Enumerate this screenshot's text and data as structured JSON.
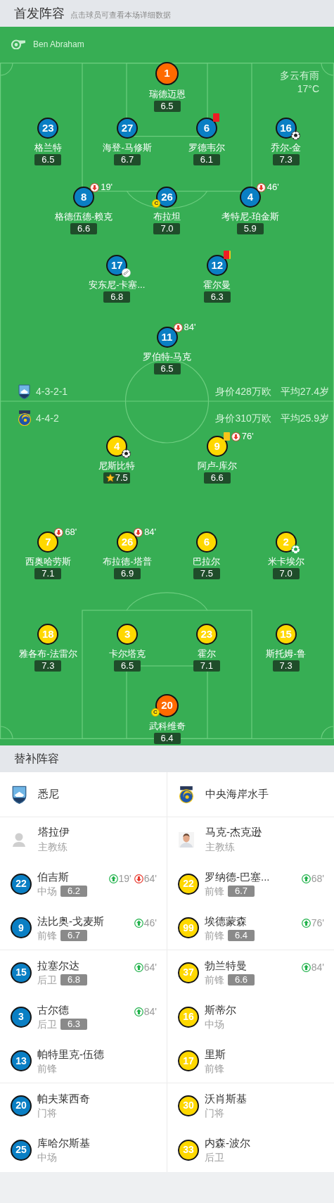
{
  "header": {
    "title": "首发阵容",
    "subtitle": "点击球员可查看本场详细数据"
  },
  "referee": {
    "name": "Ben Abraham"
  },
  "weather": {
    "condition": "多云有雨",
    "temperature": "17°C"
  },
  "home": {
    "color": "#0a7fc4",
    "formation": "4-3-2-1",
    "value": "身价428万欧",
    "avg_age": "平均27.4岁",
    "lines": [
      {
        "players": [
          {
            "kind": "goalkeeper",
            "number": "1",
            "name": "瑞德迈恩",
            "rating": "6.5",
            "mvp": false
          }
        ]
      },
      {
        "players": [
          {
            "kind": "outfield",
            "number": "23",
            "name": "格兰特",
            "rating": "6.5",
            "mvp": false
          },
          {
            "kind": "outfield",
            "number": "27",
            "name": "海登-马修斯",
            "rating": "6.7",
            "mvp": false
          },
          {
            "kind": "outfield",
            "number": "6",
            "name": "罗德韦尔",
            "rating": "6.1",
            "mvp": false,
            "events": [
              {
                "kind": "red_card"
              }
            ]
          },
          {
            "kind": "outfield",
            "number": "16",
            "name": "乔尔-金",
            "rating": "7.3",
            "mvp": false,
            "events": [
              {
                "kind": "goal",
                "color": "#222222"
              }
            ]
          }
        ]
      },
      {
        "players": [
          {
            "kind": "outfield",
            "number": "8",
            "name": "格德伍德-赖克",
            "rating": "6.6",
            "mvp": false,
            "events": [
              {
                "kind": "sub_out",
                "minute": "19'"
              }
            ]
          },
          {
            "kind": "outfield",
            "number": "26",
            "name": "布拉坦",
            "rating": "7.0",
            "mvp": false,
            "events": [
              {
                "kind": "captain",
                "label": "C"
              }
            ]
          },
          {
            "kind": "outfield",
            "number": "4",
            "name": "考特尼-珀金斯",
            "rating": "5.9",
            "mvp": false,
            "events": [
              {
                "kind": "sub_out",
                "minute": "46'"
              }
            ]
          }
        ]
      },
      {
        "players": [
          {
            "kind": "outfield",
            "number": "17",
            "name": "安东尼-卡塞...",
            "rating": "6.8",
            "mvp": false,
            "events": [
              {
                "kind": "assist"
              }
            ]
          },
          {
            "kind": "outfield",
            "number": "12",
            "name": "霍尔曼",
            "rating": "6.3",
            "mvp": false,
            "events": [
              {
                "kind": "second_yellow"
              }
            ]
          }
        ]
      },
      {
        "players": [
          {
            "kind": "outfield",
            "number": "11",
            "name": "罗伯特-马克",
            "rating": "6.5",
            "mvp": false,
            "events": [
              {
                "kind": "sub_out",
                "minute": "84'"
              }
            ]
          }
        ]
      }
    ]
  },
  "away": {
    "color": "#ffd800",
    "formation": "4-4-2",
    "value": "身价310万欧",
    "avg_age": "平均25.9岁",
    "lines": [
      {
        "players": [
          {
            "kind": "outfield",
            "number": "4",
            "name": "尼斯比特",
            "rating": "7.5",
            "mvp": true,
            "events": [
              {
                "kind": "goal",
                "color": "#222222"
              }
            ]
          },
          {
            "kind": "outfield",
            "number": "9",
            "name": "阿卢-库尔",
            "rating": "6.6",
            "mvp": false,
            "events": [
              {
                "kind": "yellow_card"
              },
              {
                "kind": "sub_out",
                "minute": "76'"
              }
            ]
          }
        ]
      },
      {
        "players": [
          {
            "kind": "outfield",
            "number": "7",
            "name": "西奥哈劳斯",
            "rating": "7.1",
            "mvp": false,
            "events": [
              {
                "kind": "sub_out",
                "minute": "68'"
              }
            ]
          },
          {
            "kind": "outfield",
            "number": "26",
            "name": "布拉德-塔普",
            "rating": "6.9",
            "mvp": false,
            "events": [
              {
                "kind": "sub_out",
                "minute": "84'"
              }
            ]
          },
          {
            "kind": "outfield",
            "number": "6",
            "name": "巴拉尔",
            "rating": "7.5",
            "mvp": false
          },
          {
            "kind": "outfield",
            "number": "2",
            "name": "米卡埃尔",
            "rating": "7.0",
            "mvp": false,
            "events": [
              {
                "kind": "goal",
                "color": "#1fa34a"
              }
            ]
          }
        ]
      },
      {
        "players": [
          {
            "kind": "outfield",
            "number": "18",
            "name": "雅各布-法雷尔",
            "rating": "7.3",
            "mvp": false
          },
          {
            "kind": "outfield",
            "number": "3",
            "name": "卡尔塔克",
            "rating": "6.5",
            "mvp": false
          },
          {
            "kind": "outfield",
            "number": "23",
            "name": "霍尔",
            "rating": "7.1",
            "mvp": false
          },
          {
            "kind": "outfield",
            "number": "15",
            "name": "斯托姆-鲁",
            "rating": "7.3",
            "mvp": false
          }
        ]
      },
      {
        "players": [
          {
            "kind": "goalkeeper",
            "number": "20",
            "name": "武科维奇",
            "rating": "6.4",
            "mvp": false,
            "events": [
              {
                "kind": "captain",
                "label": "C"
              }
            ]
          }
        ]
      }
    ]
  },
  "substitutes": {
    "title": "替补阵容",
    "teams": [
      {
        "name": "悉尼",
        "color": "#0a7fc4",
        "coach": {
          "kind": "placeholder",
          "name": "塔拉伊",
          "role": "主教练"
        },
        "players": [
          {
            "number": "22",
            "name": "伯吉斯",
            "position": "中场",
            "rating": "6.2",
            "events": [
              {
                "kind": "sub_in",
                "minute": "19'"
              },
              {
                "kind": "sub_out",
                "minute": "64'"
              }
            ]
          },
          {
            "number": "9",
            "name": "法比奥-戈麦斯",
            "position": "前锋",
            "rating": "6.7",
            "events": [
              {
                "kind": "sub_in",
                "minute": "46'"
              }
            ]
          },
          {
            "number": "15",
            "name": "拉塞尔达",
            "position": "后卫",
            "rating": "6.8",
            "events": [
              {
                "kind": "sub_in",
                "minute": "64'"
              }
            ]
          },
          {
            "number": "3",
            "name": "古尔德",
            "position": "后卫",
            "rating": "6.3",
            "events": [
              {
                "kind": "sub_in",
                "minute": "84'"
              }
            ]
          },
          {
            "number": "13",
            "name": "帕特里克-伍德",
            "position": "前锋"
          },
          {
            "number": "20",
            "name": "帕夫莱西奇",
            "position": "门将"
          },
          {
            "number": "25",
            "name": "库哈尔斯基",
            "position": "中场"
          }
        ]
      },
      {
        "name": "中央海岸水手",
        "color": "#ffd800",
        "coach": {
          "name": "马克-杰克逊",
          "role": "主教练"
        },
        "players": [
          {
            "number": "22",
            "name": "罗纳德-巴塞...",
            "position": "前锋",
            "rating": "6.7",
            "events": [
              {
                "kind": "sub_in",
                "minute": "68'"
              }
            ]
          },
          {
            "number": "99",
            "name": "埃德蒙森",
            "position": "前锋",
            "rating": "6.4",
            "events": [
              {
                "kind": "sub_in",
                "minute": "76'"
              }
            ]
          },
          {
            "number": "37",
            "name": "勃兰特曼",
            "position": "前锋",
            "rating": "6.6",
            "events": [
              {
                "kind": "sub_in",
                "minute": "84'"
              }
            ]
          },
          {
            "number": "16",
            "name": "斯蒂尔",
            "position": "中场"
          },
          {
            "number": "17",
            "name": "里斯",
            "position": "前锋"
          },
          {
            "number": "30",
            "name": "沃肖斯基",
            "position": "门将"
          },
          {
            "number": "33",
            "name": "内森-波尔",
            "position": "后卫"
          }
        ]
      }
    ]
  }
}
